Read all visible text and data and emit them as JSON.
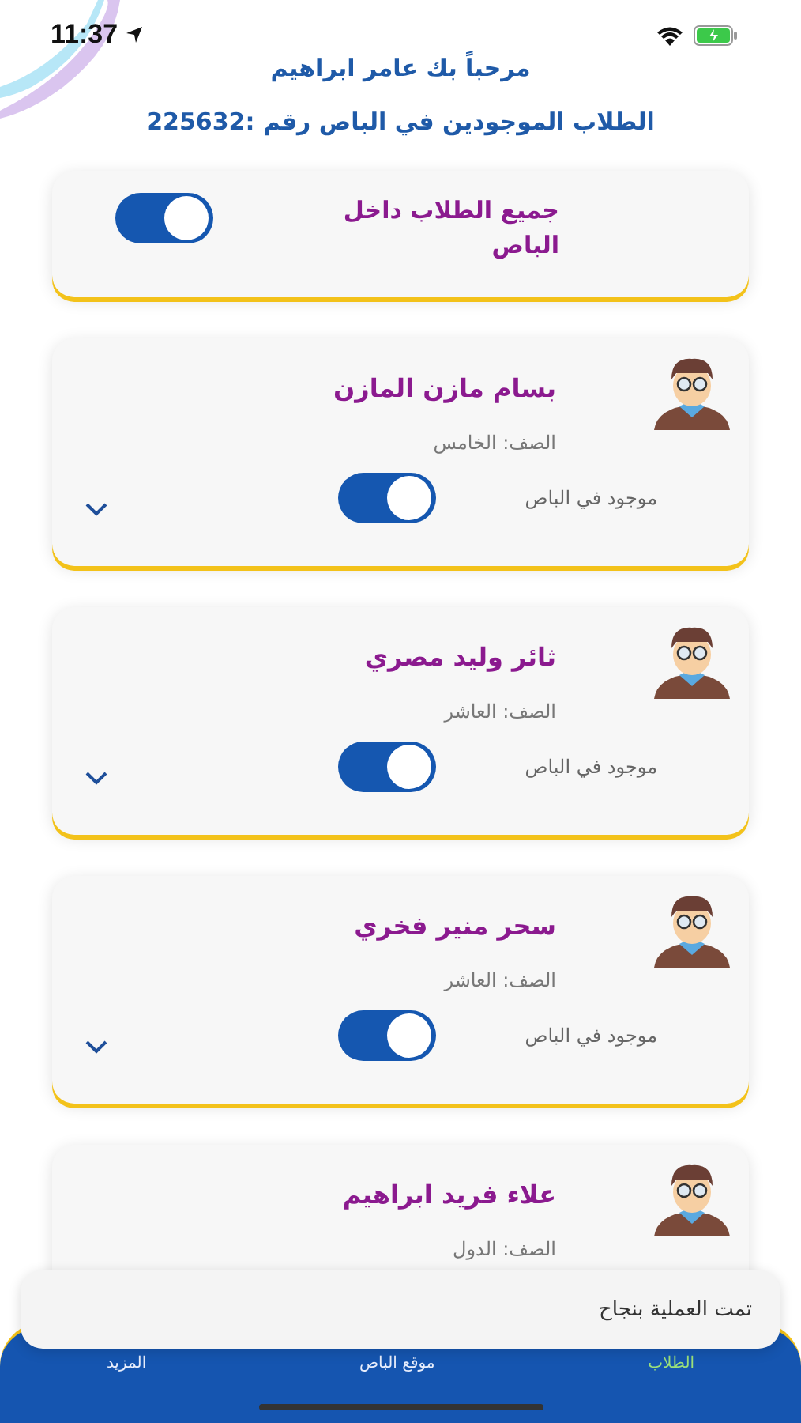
{
  "status_bar": {
    "time": "11:37"
  },
  "header": {
    "greeting": "مرحباً بك عامر ابراهيم",
    "bus_title": "الطلاب الموجودين في الباص رقم :225632"
  },
  "all_toggle": {
    "label": "جميع الطلاب داخل الباص",
    "on": true
  },
  "students": [
    {
      "name": "بسام مازن المازن",
      "grade": "الصف: الخامس",
      "presence_label": "موجود في الباص",
      "on": true
    },
    {
      "name": "ثائر وليد مصري",
      "grade": "الصف: العاشر",
      "presence_label": "موجود في الباص",
      "on": true
    },
    {
      "name": "سحر منير فخري",
      "grade": "الصف: العاشر",
      "presence_label": "موجود في الباص",
      "on": true
    },
    {
      "name": "علاء فريد ابراهيم",
      "grade": "الصف: الدول"
    }
  ],
  "bottom_nav": {
    "items": [
      {
        "label": "الطلاب",
        "selected": true
      },
      {
        "label": "موقع الباص",
        "selected": false
      },
      {
        "label": "المزيد",
        "selected": false
      }
    ]
  },
  "toast": {
    "message": "تمت العملية بنجاح"
  }
}
